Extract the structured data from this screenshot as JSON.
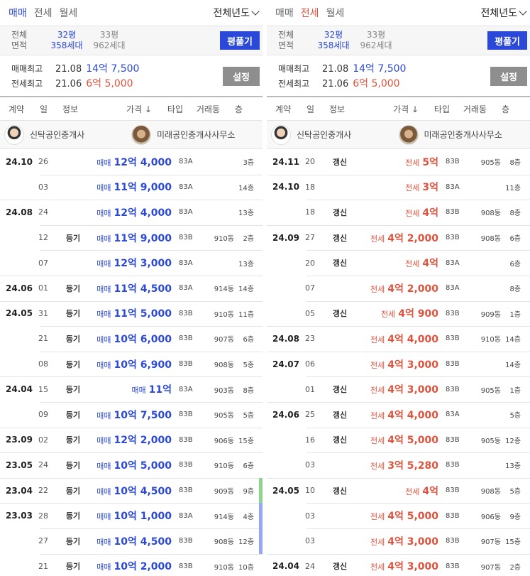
{
  "left": {
    "tabs": [
      {
        "label": "매매",
        "active": true
      },
      {
        "label": "전세",
        "active": false
      },
      {
        "label": "월세",
        "active": false
      }
    ],
    "year_select": "전체년도",
    "area": {
      "label1": "전체",
      "label2": "면적",
      "opt1": {
        "pyeong": "32평",
        "units": "358세대"
      },
      "opt2": {
        "pyeong": "33평",
        "units": "962세대"
      },
      "button": "평풀기"
    },
    "max": {
      "sale_label": "매매최고",
      "sale_date": "21.08",
      "sale_value": "14억 7,500",
      "jeonse_label": "전세최고",
      "jeonse_date": "21.06",
      "jeonse_value": "6억 5,000",
      "button": "설정"
    },
    "columns": {
      "contract": "계약",
      "day": "일",
      "info": "정보",
      "price": "가격 ↓",
      "type": "타입",
      "dong": "거래동",
      "floor": "층"
    },
    "agents": [
      "신탁공인중개사",
      "미래공인중개사사무소"
    ],
    "rows": [
      {
        "month": "24.10",
        "day": "26",
        "info": "",
        "kind": "매매",
        "price": "12억 4,000",
        "type": "83A",
        "dong": "",
        "floor": "3층"
      },
      {
        "month": "",
        "day": "03",
        "info": "",
        "kind": "매매",
        "price": "11억 9,000",
        "type": "83A",
        "dong": "",
        "floor": "14층"
      },
      {
        "month": "24.08",
        "day": "24",
        "info": "",
        "kind": "매매",
        "price": "12억 4,000",
        "type": "83A",
        "dong": "",
        "floor": "13층"
      },
      {
        "month": "",
        "day": "12",
        "info": "등기",
        "kind": "매매",
        "price": "11억 9,000",
        "type": "83B",
        "dong": "910동",
        "floor": "2층"
      },
      {
        "month": "",
        "day": "07",
        "info": "",
        "kind": "매매",
        "price": "12억 3,000",
        "type": "83A",
        "dong": "",
        "floor": "13층"
      },
      {
        "month": "24.06",
        "day": "01",
        "info": "등기",
        "kind": "매매",
        "price": "11억 4,500",
        "type": "83A",
        "dong": "914동",
        "floor": "14층"
      },
      {
        "month": "24.05",
        "day": "31",
        "info": "등기",
        "kind": "매매",
        "price": "11억 5,000",
        "type": "83B",
        "dong": "910동",
        "floor": "11층"
      },
      {
        "month": "",
        "day": "21",
        "info": "등기",
        "kind": "매매",
        "price": "10억 6,000",
        "type": "83B",
        "dong": "907동",
        "floor": "6층"
      },
      {
        "month": "",
        "day": "08",
        "info": "등기",
        "kind": "매매",
        "price": "10억 6,900",
        "type": "83B",
        "dong": "908동",
        "floor": "5층"
      },
      {
        "month": "24.04",
        "day": "15",
        "info": "등기",
        "kind": "매매",
        "price": "11억",
        "type": "83A",
        "dong": "903동",
        "floor": "8층"
      },
      {
        "month": "",
        "day": "09",
        "info": "등기",
        "kind": "매매",
        "price": "10억 7,500",
        "type": "83B",
        "dong": "905동",
        "floor": "5층"
      },
      {
        "month": "23.09",
        "day": "02",
        "info": "등기",
        "kind": "매매",
        "price": "12억 2,000",
        "type": "83B",
        "dong": "906동",
        "floor": "15층"
      },
      {
        "month": "23.05",
        "day": "24",
        "info": "등기",
        "kind": "매매",
        "price": "10억 5,000",
        "type": "83B",
        "dong": "910동",
        "floor": "6층"
      },
      {
        "month": "23.04",
        "day": "22",
        "info": "등기",
        "kind": "매매",
        "price": "10억 4,500",
        "type": "83B",
        "dong": "909동",
        "floor": "9층",
        "bar": "#8fd48f"
      },
      {
        "month": "23.03",
        "day": "28",
        "info": "등기",
        "kind": "매매",
        "price": "10억 1,000",
        "type": "83A",
        "dong": "914동",
        "floor": "4층",
        "bar": "#9aa6f0"
      },
      {
        "month": "",
        "day": "27",
        "info": "등기",
        "kind": "매매",
        "price": "10억 4,500",
        "type": "83B",
        "dong": "908동",
        "floor": "12층",
        "bar": "#9aa6f0"
      },
      {
        "month": "",
        "day": "21",
        "info": "등기",
        "kind": "매매",
        "price": "10억 2,000",
        "type": "83B",
        "dong": "910동",
        "floor": "10층"
      }
    ]
  },
  "right": {
    "tabs": [
      {
        "label": "매매",
        "active": false
      },
      {
        "label": "전세",
        "active": true
      },
      {
        "label": "월세",
        "active": false
      }
    ],
    "year_select": "전체년도",
    "area": {
      "label1": "전체",
      "label2": "면적",
      "opt1": {
        "pyeong": "32평",
        "units": "358세대"
      },
      "opt2": {
        "pyeong": "33평",
        "units": "962세대"
      },
      "button": "평풀기"
    },
    "max": {
      "sale_label": "매매최고",
      "sale_date": "21.08",
      "sale_value": "14억 7,500",
      "jeonse_label": "전세최고",
      "jeonse_date": "21.06",
      "jeonse_value": "6억 5,000",
      "button": "설정"
    },
    "columns": {
      "contract": "계약",
      "day": "일",
      "info": "정보",
      "price": "가격 ↓",
      "type": "타입",
      "dong": "거래동",
      "floor": "층"
    },
    "agents": [
      "신탁공인중개사",
      "미래공인중개사사무소"
    ],
    "rows": [
      {
        "month": "24.11",
        "day": "20",
        "info": "갱신",
        "kind": "전세",
        "price": "5억",
        "type": "83B",
        "dong": "905동",
        "floor": "8층"
      },
      {
        "month": "24.10",
        "day": "18",
        "info": "",
        "kind": "전세",
        "price": "3억",
        "type": "83A",
        "dong": "",
        "floor": "11층"
      },
      {
        "month": "",
        "day": "18",
        "info": "갱신",
        "kind": "전세",
        "price": "4억",
        "type": "83B",
        "dong": "908동",
        "floor": "8층"
      },
      {
        "month": "24.09",
        "day": "27",
        "info": "갱신",
        "kind": "전세",
        "price": "4억 2,000",
        "type": "83B",
        "dong": "908동",
        "floor": "6층"
      },
      {
        "month": "",
        "day": "20",
        "info": "갱신",
        "kind": "전세",
        "price": "4억",
        "type": "83A",
        "dong": "",
        "floor": "6층"
      },
      {
        "month": "",
        "day": "07",
        "info": "",
        "kind": "전세",
        "price": "4억 2,000",
        "type": "83A",
        "dong": "",
        "floor": "8층"
      },
      {
        "month": "",
        "day": "05",
        "info": "갱신",
        "kind": "전세",
        "price": "4억 900",
        "type": "83B",
        "dong": "909동",
        "floor": "1층"
      },
      {
        "month": "24.08",
        "day": "23",
        "info": "",
        "kind": "전세",
        "price": "4억 4,000",
        "type": "83B",
        "dong": "910동",
        "floor": "14층"
      },
      {
        "month": "24.07",
        "day": "06",
        "info": "",
        "kind": "전세",
        "price": "4억 3,000",
        "type": "83B",
        "dong": "",
        "floor": "14층"
      },
      {
        "month": "",
        "day": "01",
        "info": "갱신",
        "kind": "전세",
        "price": "4억 3,000",
        "type": "83B",
        "dong": "905동",
        "floor": "1층"
      },
      {
        "month": "24.06",
        "day": "25",
        "info": "갱신",
        "kind": "전세",
        "price": "4억 4,000",
        "type": "83A",
        "dong": "",
        "floor": "5층"
      },
      {
        "month": "",
        "day": "16",
        "info": "갱신",
        "kind": "전세",
        "price": "4억 5,000",
        "type": "83B",
        "dong": "905동",
        "floor": "12층"
      },
      {
        "month": "",
        "day": "03",
        "info": "",
        "kind": "전세",
        "price": "3억 5,280",
        "type": "83B",
        "dong": "",
        "floor": "13층"
      },
      {
        "month": "24.05",
        "day": "10",
        "info": "갱신",
        "kind": "전세",
        "price": "4억",
        "type": "83B",
        "dong": "908동",
        "floor": "5층"
      },
      {
        "month": "",
        "day": "03",
        "info": "",
        "kind": "전세",
        "price": "4억 5,000",
        "type": "83B",
        "dong": "906동",
        "floor": "9층"
      },
      {
        "month": "",
        "day": "03",
        "info": "",
        "kind": "전세",
        "price": "4억 3,000",
        "type": "83B",
        "dong": "907동",
        "floor": "15층"
      },
      {
        "month": "24.04",
        "day": "24",
        "info": "갱신",
        "kind": "전세",
        "price": "4억 3,000",
        "type": "83B",
        "dong": "907동",
        "floor": "2층"
      }
    ]
  }
}
